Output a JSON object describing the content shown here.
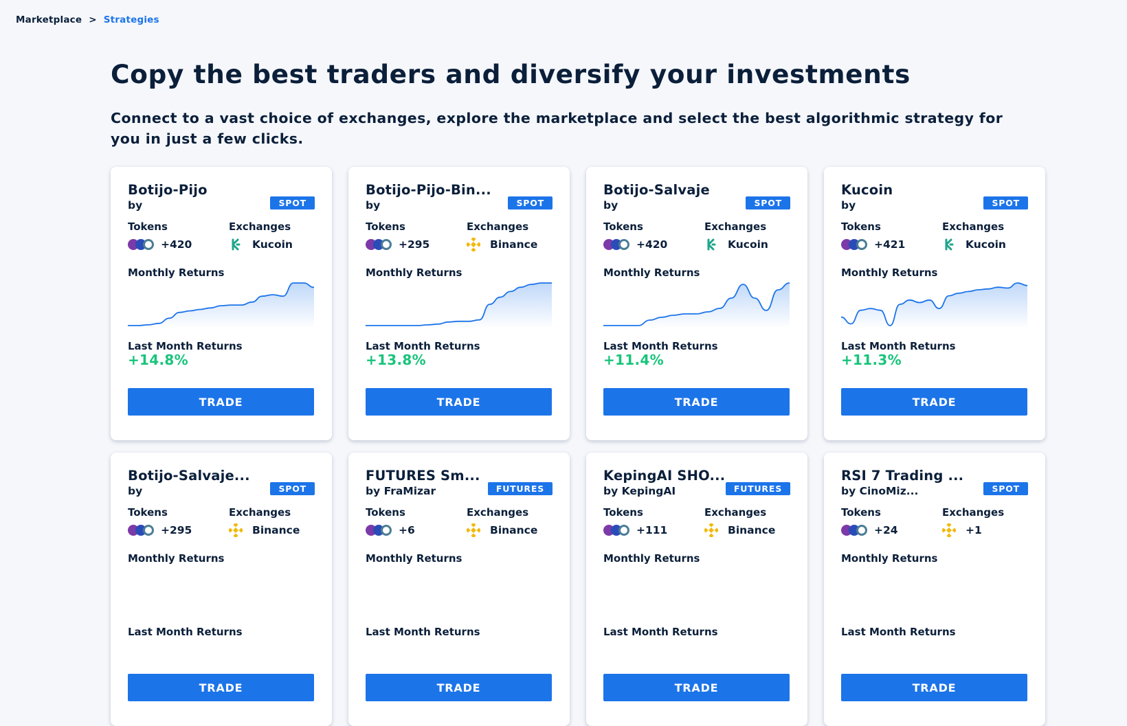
{
  "breadcrumb": {
    "home": "Marketplace",
    "separator": ">",
    "current": "Strategies"
  },
  "header": {
    "title": "Copy the best traders and diversify your investments",
    "subtitle": "Connect to a vast choice of exchanges, explore the marketplace and select the best algorithmic strategy for you in just a few clicks."
  },
  "labels": {
    "tokens": "Tokens",
    "exchanges": "Exchanges",
    "monthly_returns": "Monthly Returns",
    "last_month_returns": "Last Month Returns",
    "trade": "TRADE"
  },
  "colors": {
    "accent": "#1c74e9",
    "positive": "#18c47b",
    "text": "#0b1f3a"
  },
  "cards": [
    {
      "name": "Botijo-Pijo",
      "author": "by",
      "type": "SPOT",
      "tokens_more": "+420",
      "exchange": "Kucoin",
      "exchange_icon": "kucoin-icon",
      "last_month": "+14.8%",
      "returns": [
        0,
        0,
        1,
        3,
        10,
        18,
        20,
        22,
        24,
        27,
        28,
        28,
        32,
        40,
        42,
        40,
        58,
        58,
        52
      ]
    },
    {
      "name": "Botijo-Pijo-Bin...",
      "author": "by",
      "type": "SPOT",
      "tokens_more": "+295",
      "exchange": "Binance",
      "exchange_icon": "binance-icon",
      "last_month": "+13.8%",
      "returns": [
        0,
        0,
        0,
        0,
        0,
        0,
        1,
        2,
        5,
        6,
        6,
        8,
        30,
        40,
        48,
        54,
        58,
        60,
        60
      ]
    },
    {
      "name": "Botijo-Salvaje",
      "author": "by",
      "type": "SPOT",
      "tokens_more": "+420",
      "exchange": "Kucoin",
      "exchange_icon": "kucoin-icon",
      "last_month": "+11.4%",
      "returns": [
        0,
        0,
        0,
        0,
        8,
        12,
        15,
        17,
        17,
        20,
        25,
        40,
        60,
        40,
        22,
        52,
        62
      ]
    },
    {
      "name": "Kucoin",
      "author": "by",
      "type": "SPOT",
      "tokens_more": "+421",
      "exchange": "Kucoin",
      "exchange_icon": "kucoin-icon",
      "last_month": "+11.3%",
      "returns": [
        20,
        12,
        28,
        30,
        28,
        10,
        35,
        40,
        37,
        40,
        30,
        45,
        48,
        50,
        52,
        53,
        55,
        54,
        60,
        57
      ]
    },
    {
      "name": "Botijo-Salvaje...",
      "author": "by",
      "type": "SPOT",
      "tokens_more": "+295",
      "exchange": "Binance",
      "exchange_icon": "binance-icon",
      "last_month": "",
      "returns": []
    },
    {
      "name": "FUTURES Sm...",
      "author": "by FraMizar",
      "type": "FUTURES",
      "tokens_more": "+6",
      "exchange": "Binance",
      "exchange_icon": "binance-icon",
      "last_month": "",
      "returns": []
    },
    {
      "name": "KepingAI SHO...",
      "author": "by KepingAI",
      "type": "FUTURES",
      "tokens_more": "+111",
      "exchange": "Binance",
      "exchange_icon": "binance-icon",
      "last_month": "",
      "returns": []
    },
    {
      "name": "RSI 7 Trading ...",
      "author": "by CinoMiz...",
      "type": "SPOT",
      "tokens_more": "+24",
      "exchange": "+1",
      "exchange_icon": "binance-icon",
      "last_month": "",
      "returns": []
    }
  ]
}
